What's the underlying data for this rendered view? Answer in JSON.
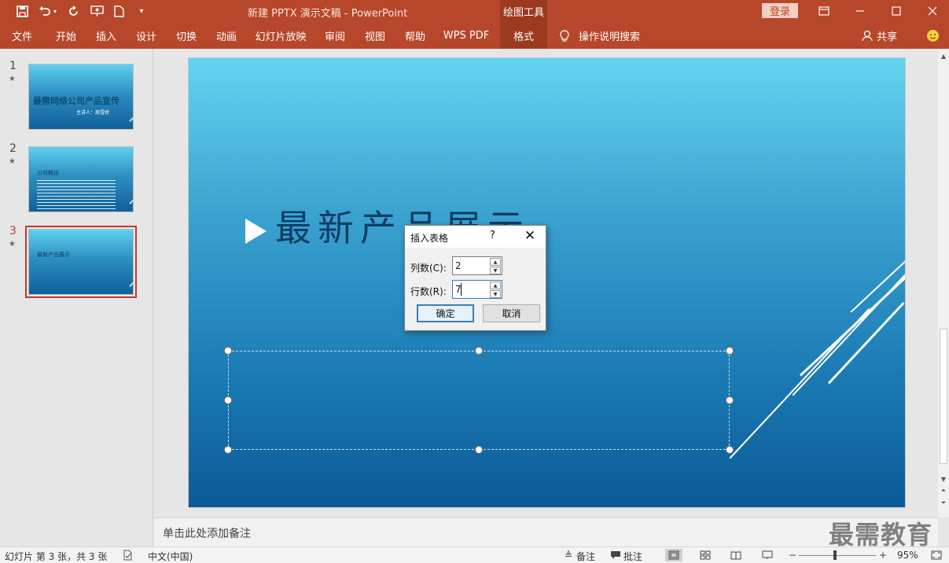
{
  "titlebar": {
    "title": "新建 PPTX 演示文稿  -  PowerPoint",
    "context_tab": "绘图工具",
    "login": "登录"
  },
  "ribbon": {
    "tabs": [
      "文件",
      "开始",
      "插入",
      "设计",
      "切换",
      "动画",
      "幻灯片放映",
      "审阅",
      "视图",
      "帮助",
      "WPS PDF",
      "格式"
    ],
    "active_tab": "格式",
    "tell_me": "操作说明搜索",
    "share": "共享"
  },
  "slides": [
    {
      "number": "1",
      "title": "最需网络公司产品宣传",
      "subtitle": "主讲人：周雪娇"
    },
    {
      "number": "2",
      "title": "公司概括"
    },
    {
      "number": "3",
      "title": "最新产品展示"
    }
  ],
  "selected_slide": 3,
  "slide": {
    "title": "最新产品展示"
  },
  "dialog": {
    "title": "插入表格",
    "help": "?",
    "columns_label": "列数(C):",
    "columns_value": "2",
    "rows_label": "行数(R):",
    "rows_value": "7",
    "ok": "确定",
    "cancel": "取消"
  },
  "notes": {
    "placeholder": "单击此处添加备注"
  },
  "watermark": "最需教育",
  "statusbar": {
    "slide_info": "幻灯片 第 3 张，共 3 张",
    "language": "中文(中国)",
    "notes": "备注",
    "comments": "批注",
    "zoom": "95%",
    "zoom_level": 0.95
  }
}
